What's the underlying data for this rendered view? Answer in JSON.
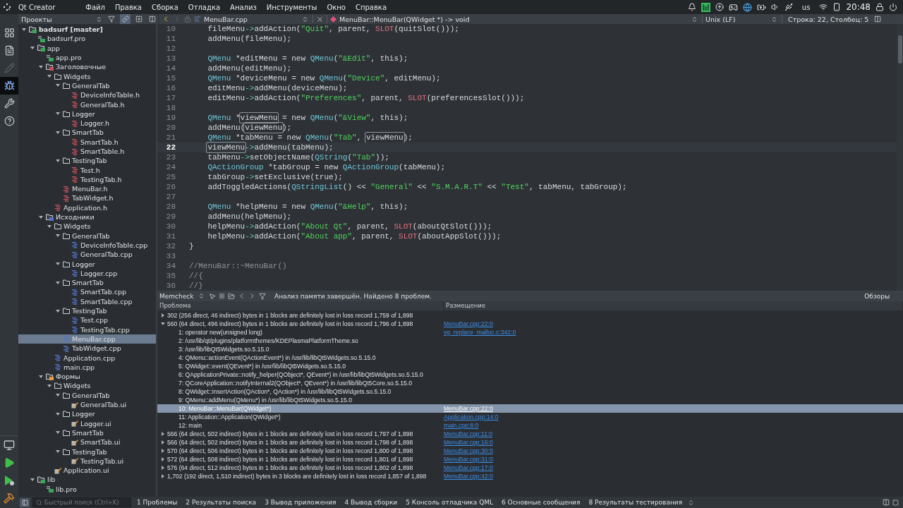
{
  "top_panel": {
    "app_title": "Qt Creator",
    "menu": [
      "Файл",
      "Правка",
      "Сборка",
      "Отладка",
      "Анализ",
      "Инструменты",
      "Окно",
      "Справка"
    ],
    "keyboard_layout": "us",
    "clock": "20:48"
  },
  "modes": [
    {
      "kind": "welcome",
      "selected": false,
      "disabled": false
    },
    {
      "kind": "edit",
      "selected": false,
      "disabled": false
    },
    {
      "kind": "design",
      "selected": false,
      "disabled": true
    },
    {
      "kind": "debug",
      "selected": true,
      "disabled": false
    },
    {
      "kind": "projects",
      "selected": false,
      "disabled": false
    },
    {
      "kind": "help",
      "selected": false,
      "disabled": false
    }
  ],
  "sidebar": {
    "title": "Проекты"
  },
  "tree": [
    {
      "label": "badsurf [master]",
      "kind": "project",
      "selected": false,
      "expanded": true,
      "children": [
        {
          "label": "badsurf.pro",
          "kind": "pro",
          "selected": false
        },
        {
          "label": "app",
          "kind": "project",
          "selected": false,
          "expanded": true,
          "children": [
            {
              "label": "app.pro",
              "kind": "pro",
              "selected": false
            },
            {
              "label": "Заголовочные",
              "kind": "headers",
              "selected": false,
              "expanded": true,
              "children": [
                {
                  "label": "Widgets",
                  "kind": "folder",
                  "selected": false,
                  "expanded": true,
                  "children": [
                    {
                      "label": "GeneralTab",
                      "kind": "folder",
                      "selected": false,
                      "expanded": true,
                      "children": [
                        {
                          "label": "DeviceInfoTable.h",
                          "kind": "header",
                          "selected": false
                        },
                        {
                          "label": "GeneralTab.h",
                          "kind": "header",
                          "selected": false
                        }
                      ]
                    },
                    {
                      "label": "Logger",
                      "kind": "folder",
                      "selected": false,
                      "expanded": true,
                      "children": [
                        {
                          "label": "Logger.h",
                          "kind": "header",
                          "selected": false
                        }
                      ]
                    },
                    {
                      "label": "SmartTab",
                      "kind": "folder",
                      "selected": false,
                      "expanded": true,
                      "children": [
                        {
                          "label": "SmartTab.h",
                          "kind": "header",
                          "selected": false
                        },
                        {
                          "label": "SmartTable.h",
                          "kind": "header",
                          "selected": false
                        }
                      ]
                    },
                    {
                      "label": "TestingTab",
                      "kind": "folder",
                      "selected": false,
                      "expanded": true,
                      "children": [
                        {
                          "label": "Test.h",
                          "kind": "header",
                          "selected": false
                        },
                        {
                          "label": "TestingTab.h",
                          "kind": "header",
                          "selected": false
                        }
                      ]
                    },
                    {
                      "label": "MenuBar.h",
                      "kind": "header",
                      "selected": false
                    },
                    {
                      "label": "TabWidget.h",
                      "kind": "header",
                      "selected": false
                    }
                  ]
                },
                {
                  "label": "Application.h",
                  "kind": "header",
                  "selected": false
                }
              ]
            },
            {
              "label": "Исходники",
              "kind": "sources",
              "selected": false,
              "expanded": true,
              "children": [
                {
                  "label": "Widgets",
                  "kind": "folder",
                  "selected": false,
                  "expanded": true,
                  "children": [
                    {
                      "label": "GeneralTab",
                      "kind": "folder",
                      "selected": false,
                      "expanded": true,
                      "children": [
                        {
                          "label": "DeviceInfoTable.cpp",
                          "kind": "source",
                          "selected": false
                        },
                        {
                          "label": "GeneralTab.cpp",
                          "kind": "source",
                          "selected": false
                        }
                      ]
                    },
                    {
                      "label": "Logger",
                      "kind": "folder",
                      "selected": false,
                      "expanded": true,
                      "children": [
                        {
                          "label": "Logger.cpp",
                          "kind": "source",
                          "selected": false
                        }
                      ]
                    },
                    {
                      "label": "SmartTab",
                      "kind": "folder",
                      "selected": false,
                      "expanded": true,
                      "children": [
                        {
                          "label": "SmartTab.cpp",
                          "kind": "source",
                          "selected": false
                        },
                        {
                          "label": "SmartTable.cpp",
                          "kind": "source",
                          "selected": false
                        }
                      ]
                    },
                    {
                      "label": "TestingTab",
                      "kind": "folder",
                      "selected": false,
                      "expanded": true,
                      "children": [
                        {
                          "label": "Test.cpp",
                          "kind": "source",
                          "selected": false
                        },
                        {
                          "label": "TestingTab.cpp",
                          "kind": "source",
                          "selected": false
                        }
                      ]
                    },
                    {
                      "label": "MenuBar.cpp",
                      "kind": "source",
                      "selected": true
                    },
                    {
                      "label": "TabWidget.cpp",
                      "kind": "source",
                      "selected": false
                    }
                  ]
                },
                {
                  "label": "Application.cpp",
                  "kind": "source",
                  "selected": false
                },
                {
                  "label": "main.cpp",
                  "kind": "source",
                  "selected": false
                }
              ]
            },
            {
              "label": "Формы",
              "kind": "forms",
              "selected": false,
              "expanded": true,
              "children": [
                {
                  "label": "Widgets",
                  "kind": "folder",
                  "selected": false,
                  "expanded": true,
                  "children": [
                    {
                      "label": "GeneralTab",
                      "kind": "folder",
                      "selected": false,
                      "expanded": true,
                      "children": [
                        {
                          "label": "GeneralTab.ui",
                          "kind": "ui",
                          "selected": false
                        }
                      ]
                    },
                    {
                      "label": "Logger",
                      "kind": "folder",
                      "selected": false,
                      "expanded": true,
                      "children": [
                        {
                          "label": "Logger.ui",
                          "kind": "ui",
                          "selected": false
                        }
                      ]
                    },
                    {
                      "label": "SmartTab",
                      "kind": "folder",
                      "selected": false,
                      "expanded": true,
                      "children": [
                        {
                          "label": "SmartTab.ui",
                          "kind": "ui",
                          "selected": false
                        }
                      ]
                    },
                    {
                      "label": "TestingTab",
                      "kind": "folder",
                      "selected": false,
                      "expanded": true,
                      "children": [
                        {
                          "label": "TestingTab.ui",
                          "kind": "ui",
                          "selected": false
                        }
                      ]
                    }
                  ]
                },
                {
                  "label": "Application.ui",
                  "kind": "ui",
                  "selected": false
                }
              ]
            }
          ]
        },
        {
          "label": "lib",
          "kind": "project",
          "selected": false,
          "expanded": true,
          "children": [
            {
              "label": "lib.pro",
              "kind": "pro",
              "selected": false
            }
          ]
        }
      ]
    }
  ],
  "editor": {
    "file": "MenuBar.cpp",
    "symbol": "MenuBar::MenuBar(QWidget *) -> void",
    "line_ending": "Unix (LF)",
    "position": "Строка: 22, Столбец: 5",
    "lines": [
      {
        "number": "10",
        "current": false,
        "indented": true,
        "segments": [
          {
            "kind": "plain",
            "text": "fileMenu"
          },
          {
            "kind": "op",
            "text": "->"
          },
          {
            "kind": "plain",
            "text": "addAction("
          },
          {
            "kind": "string",
            "text": "\"Quit\""
          },
          {
            "kind": "plain",
            "text": ", parent, "
          },
          {
            "kind": "macro",
            "text": "SLOT"
          },
          {
            "kind": "plain",
            "text": "(quitSlot()));"
          }
        ]
      },
      {
        "number": "11",
        "current": false,
        "indented": true,
        "segments": [
          {
            "kind": "plain",
            "text": "addMenu(fileMenu);"
          }
        ]
      },
      {
        "number": "12",
        "current": false
      },
      {
        "number": "13",
        "current": false,
        "indented": true,
        "segments": [
          {
            "kind": "type",
            "text": "QMenu"
          },
          {
            "kind": "plain",
            "text": " *editMenu = new "
          },
          {
            "kind": "type",
            "text": "QMenu"
          },
          {
            "kind": "plain",
            "text": "("
          },
          {
            "kind": "string",
            "text": "\"&Edit\""
          },
          {
            "kind": "plain",
            "text": ", this);"
          }
        ]
      },
      {
        "number": "14",
        "current": false,
        "indented": true,
        "segments": [
          {
            "kind": "plain",
            "text": "addMenu(editMenu);"
          }
        ]
      },
      {
        "number": "15",
        "current": false,
        "indented": true,
        "segments": [
          {
            "kind": "type",
            "text": "QMenu"
          },
          {
            "kind": "plain",
            "text": " *deviceMenu = new "
          },
          {
            "kind": "type",
            "text": "QMenu"
          },
          {
            "kind": "plain",
            "text": "("
          },
          {
            "kind": "string",
            "text": "\"Device\""
          },
          {
            "kind": "plain",
            "text": ", editMenu);"
          }
        ]
      },
      {
        "number": "16",
        "current": false,
        "indented": true,
        "segments": [
          {
            "kind": "plain",
            "text": "editMenu"
          },
          {
            "kind": "op",
            "text": "->"
          },
          {
            "kind": "plain",
            "text": "addMenu(deviceMenu);"
          }
        ]
      },
      {
        "number": "17",
        "current": false,
        "indented": true,
        "segments": [
          {
            "kind": "plain",
            "text": "editMenu"
          },
          {
            "kind": "op",
            "text": "->"
          },
          {
            "kind": "plain",
            "text": "addAction("
          },
          {
            "kind": "string",
            "text": "\"Preferences\""
          },
          {
            "kind": "plain",
            "text": ", parent, "
          },
          {
            "kind": "macro",
            "text": "SLOT"
          },
          {
            "kind": "plain",
            "text": "(preferencesSlot()));"
          }
        ]
      },
      {
        "number": "18",
        "current": false
      },
      {
        "number": "19",
        "current": false,
        "indented": true,
        "segments": [
          {
            "kind": "type",
            "text": "QMenu"
          },
          {
            "kind": "plain",
            "text": " *"
          },
          {
            "kind": "occurrence",
            "text": "viewMenu"
          },
          {
            "kind": "plain",
            "text": " = new "
          },
          {
            "kind": "type",
            "text": "QMenu"
          },
          {
            "kind": "plain",
            "text": "("
          },
          {
            "kind": "string",
            "text": "\"&View\""
          },
          {
            "kind": "plain",
            "text": ", this);"
          }
        ]
      },
      {
        "number": "20",
        "current": false,
        "indented": true,
        "segments": [
          {
            "kind": "plain",
            "text": "addMenu("
          },
          {
            "kind": "occurrence",
            "text": "viewMenu"
          },
          {
            "kind": "plain",
            "text": ");"
          }
        ]
      },
      {
        "number": "21",
        "current": false,
        "indented": true,
        "segments": [
          {
            "kind": "type",
            "text": "QMenu"
          },
          {
            "kind": "plain",
            "text": " *tabMenu = new "
          },
          {
            "kind": "type",
            "text": "QMenu"
          },
          {
            "kind": "plain",
            "text": "("
          },
          {
            "kind": "string",
            "text": "\"Tab\""
          },
          {
            "kind": "plain",
            "text": ", "
          },
          {
            "kind": "occurrence",
            "text": "viewMenu"
          },
          {
            "kind": "plain",
            "text": ");"
          }
        ]
      },
      {
        "number": "22",
        "current": true,
        "indented": true,
        "segments": [
          {
            "kind": "occurrence",
            "text": "viewMenu"
          },
          {
            "kind": "op",
            "text": "->"
          },
          {
            "kind": "plain",
            "text": "addMenu(tabMenu);"
          }
        ]
      },
      {
        "number": "23",
        "current": false,
        "indented": true,
        "segments": [
          {
            "kind": "plain",
            "text": "tabMenu"
          },
          {
            "kind": "op",
            "text": "->"
          },
          {
            "kind": "plain",
            "text": "setObjectName("
          },
          {
            "kind": "type",
            "text": "QString"
          },
          {
            "kind": "plain",
            "text": "("
          },
          {
            "kind": "string",
            "text": "\"Tab\""
          },
          {
            "kind": "plain",
            "text": "));"
          }
        ]
      },
      {
        "number": "24",
        "current": false,
        "indented": true,
        "segments": [
          {
            "kind": "type",
            "text": "QActionGroup"
          },
          {
            "kind": "plain",
            "text": " *tabGroup = new "
          },
          {
            "kind": "type",
            "text": "QActionGroup"
          },
          {
            "kind": "plain",
            "text": "(tabMenu);"
          }
        ]
      },
      {
        "number": "25",
        "current": false,
        "indented": true,
        "segments": [
          {
            "kind": "plain",
            "text": "tabGroup"
          },
          {
            "kind": "op",
            "text": "->"
          },
          {
            "kind": "plain",
            "text": "setExclusive(true);"
          }
        ]
      },
      {
        "number": "26",
        "current": false,
        "indented": true,
        "segments": [
          {
            "kind": "plain",
            "text": "addToggledActions("
          },
          {
            "kind": "type",
            "text": "QStringList"
          },
          {
            "kind": "plain",
            "text": "() << "
          },
          {
            "kind": "string",
            "text": "\"General\""
          },
          {
            "kind": "plain",
            "text": " << "
          },
          {
            "kind": "string",
            "text": "\"S.M.A.R.T\""
          },
          {
            "kind": "plain",
            "text": " << "
          },
          {
            "kind": "string",
            "text": "\"Test\""
          },
          {
            "kind": "plain",
            "text": ", tabMenu, tabGroup);"
          }
        ]
      },
      {
        "number": "27",
        "current": false
      },
      {
        "number": "28",
        "current": false,
        "indented": true,
        "segments": [
          {
            "kind": "type",
            "text": "QMenu"
          },
          {
            "kind": "plain",
            "text": " *helpMenu = new "
          },
          {
            "kind": "type",
            "text": "QMenu"
          },
          {
            "kind": "plain",
            "text": "("
          },
          {
            "kind": "string",
            "text": "\"&Help\""
          },
          {
            "kind": "plain",
            "text": ", this);"
          }
        ]
      },
      {
        "number": "29",
        "current": false,
        "indented": true,
        "segments": [
          {
            "kind": "plain",
            "text": "addMenu(helpMenu);"
          }
        ]
      },
      {
        "number": "30",
        "current": false,
        "indented": true,
        "segments": [
          {
            "kind": "plain",
            "text": "helpMenu"
          },
          {
            "kind": "op",
            "text": "->"
          },
          {
            "kind": "plain",
            "text": "addAction("
          },
          {
            "kind": "string",
            "text": "\"About Qt\""
          },
          {
            "kind": "plain",
            "text": ", parent, "
          },
          {
            "kind": "macro",
            "text": "SLOT"
          },
          {
            "kind": "plain",
            "text": "(aboutQtSlot()));"
          }
        ]
      },
      {
        "number": "31",
        "current": false,
        "indented": true,
        "segments": [
          {
            "kind": "plain",
            "text": "helpMenu"
          },
          {
            "kind": "op",
            "text": "->"
          },
          {
            "kind": "plain",
            "text": "addAction("
          },
          {
            "kind": "string",
            "text": "\"About app\""
          },
          {
            "kind": "plain",
            "text": ", parent, "
          },
          {
            "kind": "macro",
            "text": "SLOT"
          },
          {
            "kind": "plain",
            "text": "(aboutAppSlot()));"
          }
        ]
      },
      {
        "number": "32",
        "current": false,
        "indented": false,
        "segments": [
          {
            "kind": "plain",
            "text": "}"
          }
        ]
      },
      {
        "number": "33",
        "current": false
      },
      {
        "number": "34",
        "current": false,
        "indented": false,
        "segments": [
          {
            "kind": "comment",
            "text": "//MenuBar::~MenuBar()"
          }
        ]
      },
      {
        "number": "35",
        "current": false,
        "indented": false,
        "segments": [
          {
            "kind": "comment",
            "text": "//{"
          }
        ]
      },
      {
        "number": "36",
        "current": false,
        "indented": false,
        "segments": [
          {
            "kind": "comment",
            "text": "//}"
          }
        ]
      }
    ]
  },
  "memcheck": {
    "tool": "Memcheck",
    "message": "Анализ памяти завершён. Найдено 8 проблем.",
    "views_label": "Обзоры",
    "columns": [
      "Проблема",
      "Размещение"
    ],
    "rows": [
      {
        "text": "302 (256 direct, 46 indirect) bytes in 1 blocks are definitely lost in loss record 1,759 of 1,898",
        "expanded": false,
        "selected": false
      },
      {
        "text": "560 (64 direct, 496 indirect) bytes in 1 blocks are definitely lost in loss record 1,796 of 1,898",
        "location": "MenuBar.cpp:22:0",
        "expanded": true,
        "selected": false,
        "children": [
          {
            "text": "1: operator new(unsigned long)",
            "location": "vg_replace_malloc.c:342:0",
            "selected": false
          },
          {
            "text": "2: /usr/lib/qt/plugins/platformthemes/KDEPlasmaPlatformTheme.so",
            "selected": false
          },
          {
            "text": "3: /usr/lib/libQt5Widgets.so.5.15.0",
            "selected": false
          },
          {
            "text": "4: QMenu::actionEvent(QActionEvent*) in /usr/lib/libQt5Widgets.so.5.15.0",
            "selected": false
          },
          {
            "text": "5: QWidget::event(QEvent*) in /usr/lib/libQt5Widgets.so.5.15.0",
            "selected": false
          },
          {
            "text": "6: QApplicationPrivate::notify_helper(QObject*, QEvent*) in /usr/lib/libQt5Widgets.so.5.15.0",
            "selected": false
          },
          {
            "text": "7: QCoreApplication::notifyInternal2(QObject*, QEvent*) in /usr/lib/libQt5Core.so.5.15.0",
            "selected": false
          },
          {
            "text": "8: QWidget::insertAction(QAction*, QAction*) in /usr/lib/libQt5Widgets.so.5.15.0",
            "selected": false
          },
          {
            "text": "9: QMenu::addMenu(QMenu*) in /usr/lib/libQt5Widgets.so.5.15.0",
            "selected": false
          },
          {
            "text": "10: MenuBar::MenuBar(QWidget*)",
            "location": "MenuBar.cpp:22:0",
            "selected": true
          },
          {
            "text": "11: Application::Application(QWidget*)",
            "location": "Application.cpp:14:0",
            "selected": false
          },
          {
            "text": "12: main",
            "location": "main.cpp:8:0",
            "selected": false
          }
        ]
      },
      {
        "text": "566 (64 direct, 502 indirect) bytes in 1 blocks are definitely lost in loss record 1,797 of 1,898",
        "location": "MenuBar.cpp:11:0",
        "expanded": false,
        "selected": false
      },
      {
        "text": "566 (64 direct, 502 indirect) bytes in 1 blocks are definitely lost in loss record 1,798 of 1,898",
        "location": "MenuBar.cpp:16:0",
        "expanded": false,
        "selected": false
      },
      {
        "text": "570 (64 direct, 506 indirect) bytes in 1 blocks are definitely lost in loss record 1,800 of 1,898",
        "location": "MenuBar.cpp:30:0",
        "expanded": false,
        "selected": false
      },
      {
        "text": "572 (64 direct, 508 indirect) bytes in 1 blocks are definitely lost in loss record 1,801 of 1,898",
        "location": "MenuBar.cpp:31:0",
        "expanded": false,
        "selected": false
      },
      {
        "text": "576 (64 direct, 512 indirect) bytes in 1 blocks are definitely lost in loss record 1,802 of 1,898",
        "location": "MenuBar.cpp:17:0",
        "expanded": false,
        "selected": false
      },
      {
        "text": "1,702 (192 direct, 1,510 indirect) bytes in 3 blocks are definitely lost in loss record 1,857 of 1,898",
        "location": "MenuBar.cpp:42:0",
        "expanded": false,
        "selected": false
      }
    ]
  },
  "status_bar": {
    "search_placeholder": "Быстрый поиск (Ctrl+K)",
    "output_tabs": [
      "1 Проблемы",
      "2 Результаты поиска",
      "3 Вывод приложения",
      "4 Вывод сборки",
      "5 Консоль отладчика QML",
      "6 Основные сообщения",
      "8 Результаты тестирования"
    ]
  }
}
